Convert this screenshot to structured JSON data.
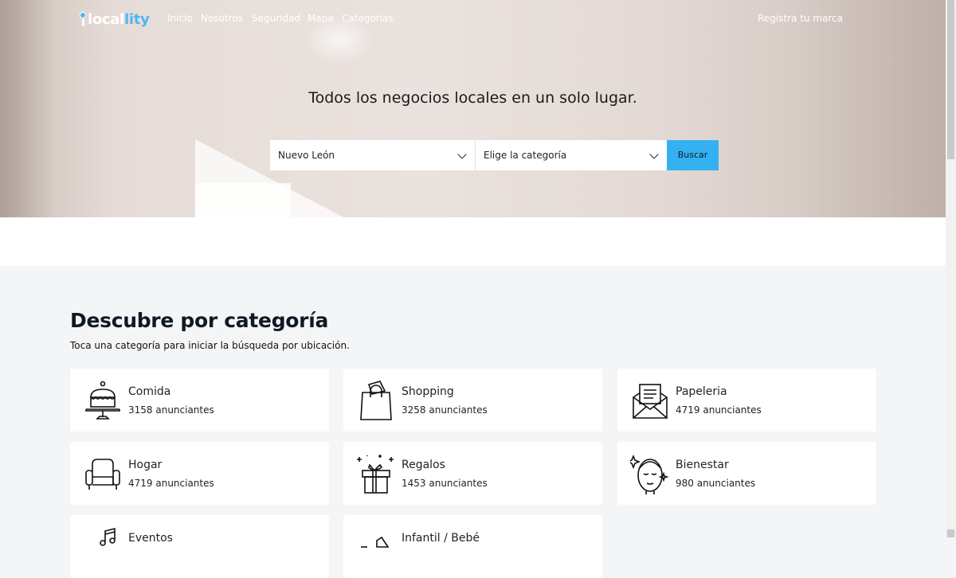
{
  "brand": {
    "logo_part1": "local",
    "logo_part2": "lity",
    "accent": "#35b0f0"
  },
  "nav": {
    "links": [
      "Inicio",
      "Nosotros",
      "Seguridad",
      "Mapa",
      "Categorías"
    ],
    "register": "Registra tu marca"
  },
  "hero": {
    "tagline": "Todos los negocios locales en un solo lugar.",
    "location_select": "Nuevo León",
    "category_select": "Elige la categoría",
    "search_button": "Buscar"
  },
  "categories_section": {
    "title": "Descubre por categoría",
    "subtitle": "Toca una categoría para iniciar la búsqueda por ubicación.",
    "items": [
      {
        "name": "Comida",
        "count": "3158 anunciantes",
        "icon": "cake-icon"
      },
      {
        "name": "Shopping",
        "count": "3258 anunciantes",
        "icon": "shopping-bag-icon"
      },
      {
        "name": "Papeleria",
        "count": "4719 anunciantes",
        "icon": "envelope-icon"
      },
      {
        "name": "Hogar",
        "count": "4719 anunciantes",
        "icon": "armchair-icon"
      },
      {
        "name": "Regalos",
        "count": "1453 anunciantes",
        "icon": "gift-icon"
      },
      {
        "name": "Bienestar",
        "count": "980 anunciantes",
        "icon": "face-mask-icon"
      },
      {
        "name": "Eventos",
        "count": "",
        "icon": "music-notes-icon"
      },
      {
        "name": "Infantil / Bebé",
        "count": "",
        "icon": "baby-icon"
      }
    ]
  }
}
